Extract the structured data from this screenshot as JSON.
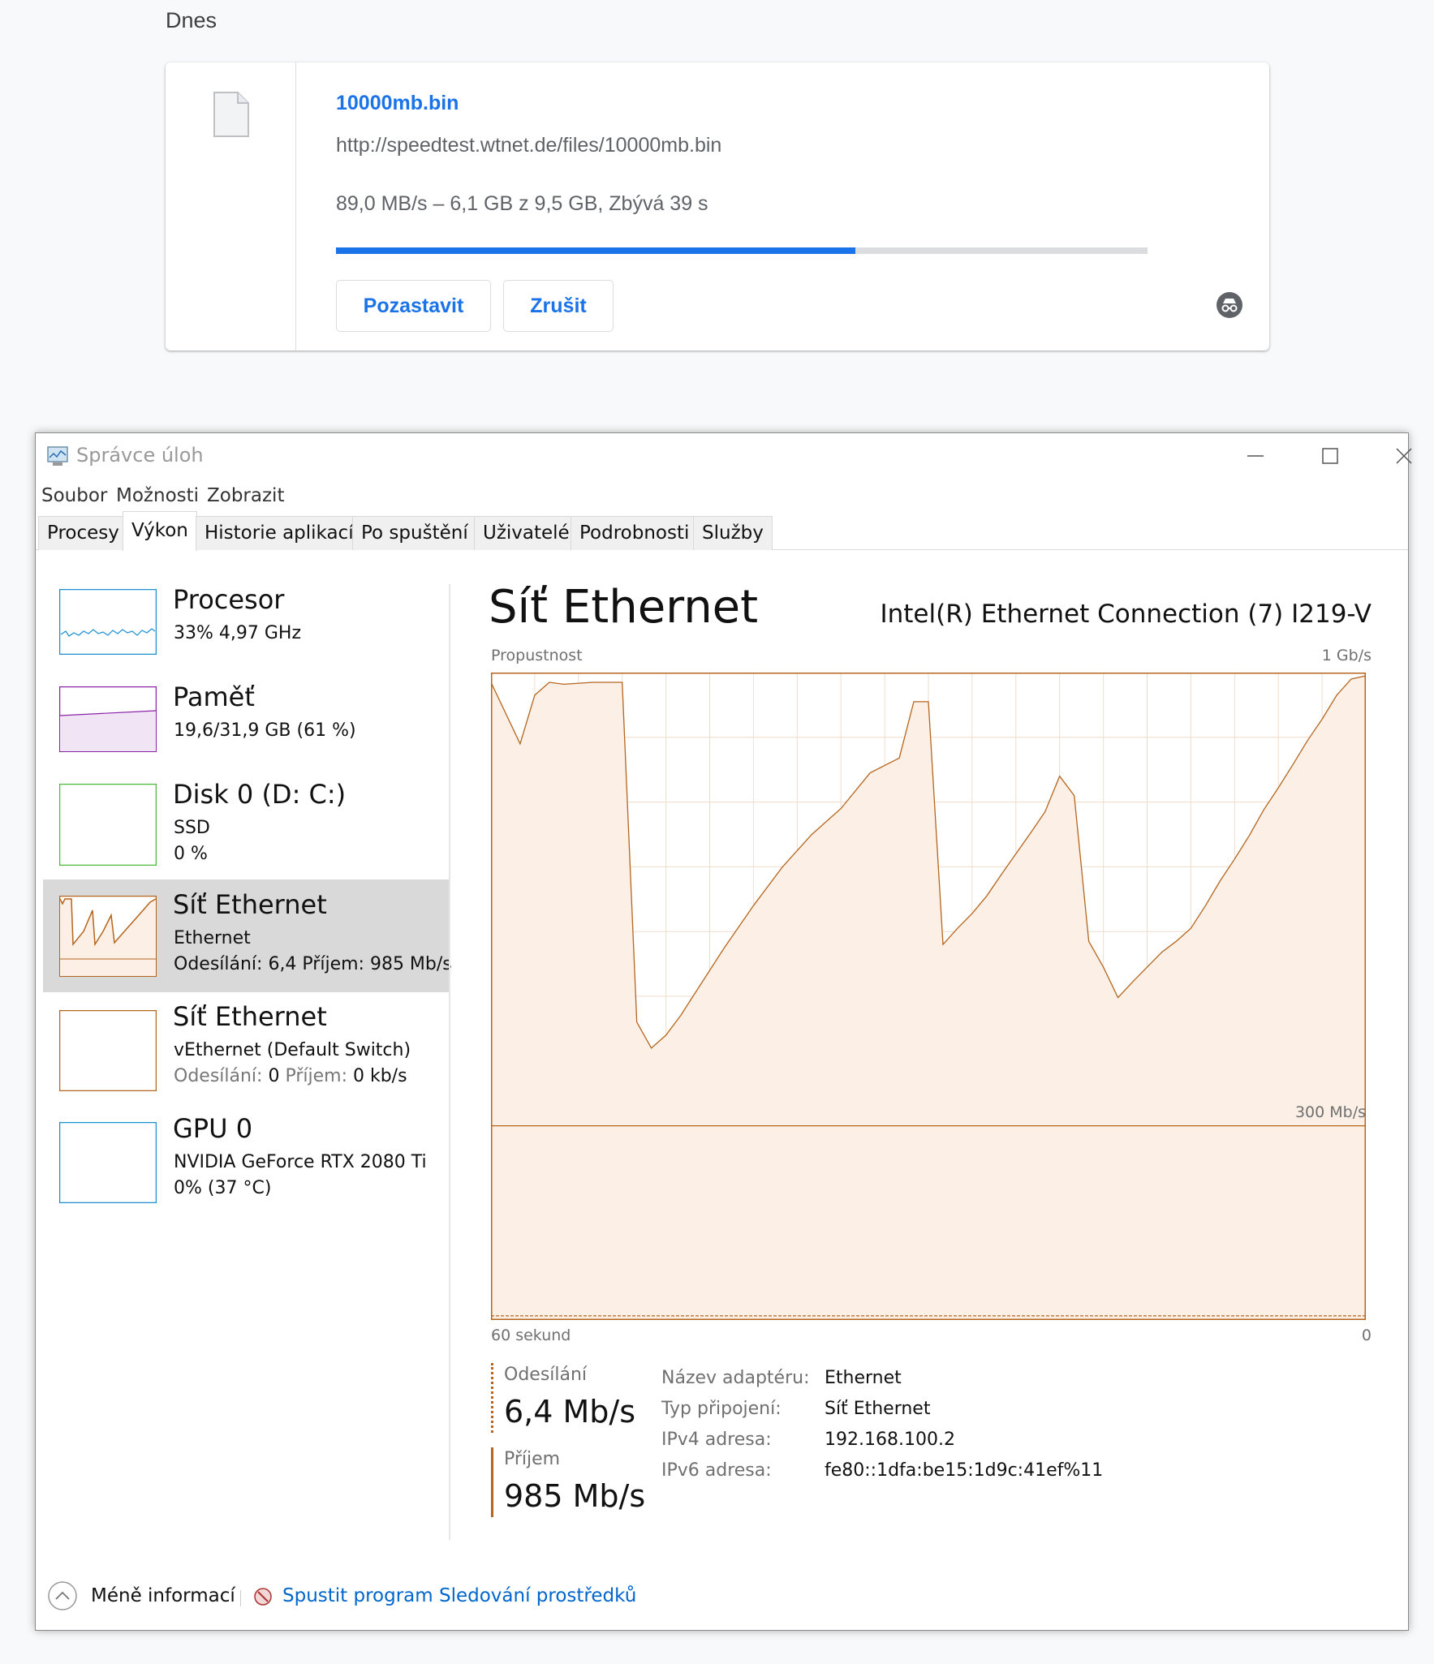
{
  "downloads": {
    "section_label": "Dnes",
    "item": {
      "filename": "10000mb.bin",
      "url": "http://speedtest.wtnet.de/files/10000mb.bin",
      "status": "89,0 MB/s – 6,1 GB z 9,5 GB, Zbývá 39 s",
      "progress": 0.64,
      "pause_label": "Pozastavit",
      "cancel_label": "Zrušit",
      "icons": {
        "file": "file-icon",
        "incognito": "incognito-icon"
      }
    },
    "colors": {
      "accent": "#1a73e8",
      "track": "#dadce0"
    }
  },
  "task_manager": {
    "title": "Správce úloh",
    "menu": [
      {
        "label": "Soubor"
      },
      {
        "label": "Možnosti"
      },
      {
        "label": "Zobrazit"
      }
    ],
    "tabs": [
      "Procesy",
      "Výkon",
      "Historie aplikací",
      "Po spuštění",
      "Uživatelé",
      "Podrobnosti",
      "Služby"
    ],
    "active_tab": "Výkon",
    "resources": [
      {
        "title": "Procesor",
        "line1": "33% 4,97 GHz",
        "color": "#1b8fd0"
      },
      {
        "title": "Paměť",
        "line1": "19,6/31,9 GB (61 %)",
        "color": "#8b22a8"
      },
      {
        "title": "Disk 0 (D: C:)",
        "line1": "SSD",
        "line2": "0 %",
        "color": "#4db83a"
      },
      {
        "title": "Síť Ethernet",
        "line1": "Ethernet",
        "line2": "Odesílání: 6,4 Příjem: 985 Mb/s",
        "color": "#b5651d",
        "selected": true
      },
      {
        "title": "Síť Ethernet",
        "line1": "vEthernet (Default Switch)",
        "line2_send_label": "Odesílání:",
        "line2_send_value": "0",
        "line2_recv_label": "Příjem:",
        "line2_recv_value": "0 kb/s",
        "color": "#b5651d"
      },
      {
        "title": "GPU 0",
        "line1": "NVIDIA GeForce RTX 2080 Ti",
        "line2": "0% (37 °C)",
        "color": "#1b8fd0"
      }
    ],
    "detail": {
      "title": "Síť Ethernet",
      "adapter": "Intel(R) Ethernet Connection (7) I219-V",
      "graph_label": "Propustnost",
      "graph_max": "1 Gb/s",
      "graph_mid": "300 Mb/s",
      "graph_time_left": "60 sekund",
      "graph_time_right": "0",
      "send_label": "Odesílání",
      "send_value": "6,4 Mb/s",
      "recv_label": "Příjem",
      "recv_value": "985 Mb/s",
      "properties": [
        {
          "key": "Název adaptéru:",
          "value": "Ethernet"
        },
        {
          "key": "Typ připojení:",
          "value": "Síť Ethernet"
        },
        {
          "key": "IPv4 adresa:",
          "value": "192.168.100.2"
        },
        {
          "key": "IPv6 adresa:",
          "value": "fe80::1dfa:be15:1d9c:41ef%11"
        }
      ]
    },
    "footer": {
      "fewer_details": "Méně informací",
      "resmon_link": "Spustit program Sledování prostředků"
    },
    "colors": {
      "net": "#b5651d",
      "net_fill": "#fbefe6",
      "grid": "#f0dccb"
    }
  },
  "chart_data": {
    "type": "area",
    "xlabel": "",
    "ylabel": "",
    "scale_max_mbps": 1000,
    "mid_marker_mbps": 300,
    "x_seconds_ago": [
      60,
      58,
      57,
      56,
      55,
      53,
      52,
      51,
      50,
      49,
      48,
      47,
      46,
      45,
      44,
      42,
      40,
      38,
      36,
      34,
      32,
      31,
      30,
      29,
      28,
      27,
      26,
      25,
      24,
      23,
      22,
      21,
      20,
      19,
      18,
      17,
      16,
      15,
      14,
      13,
      12,
      11,
      10,
      9,
      8,
      7,
      6,
      5,
      4,
      3,
      2,
      1,
      0
    ],
    "series": [
      {
        "values": [
          985,
          890,
          965,
          985,
          982,
          985,
          985,
          985,
          460,
          420,
          440,
          470,
          505,
          540,
          575,
          640,
          700,
          750,
          790,
          845,
          868,
          955,
          955,
          580,
          605,
          628,
          655,
          688,
          720,
          752,
          785,
          840,
          810,
          585,
          545,
          498,
          522,
          545,
          568,
          585,
          605,
          640,
          678,
          712,
          748,
          788,
          822,
          858,
          895,
          928,
          965,
          990,
          995
        ]
      }
    ]
  }
}
